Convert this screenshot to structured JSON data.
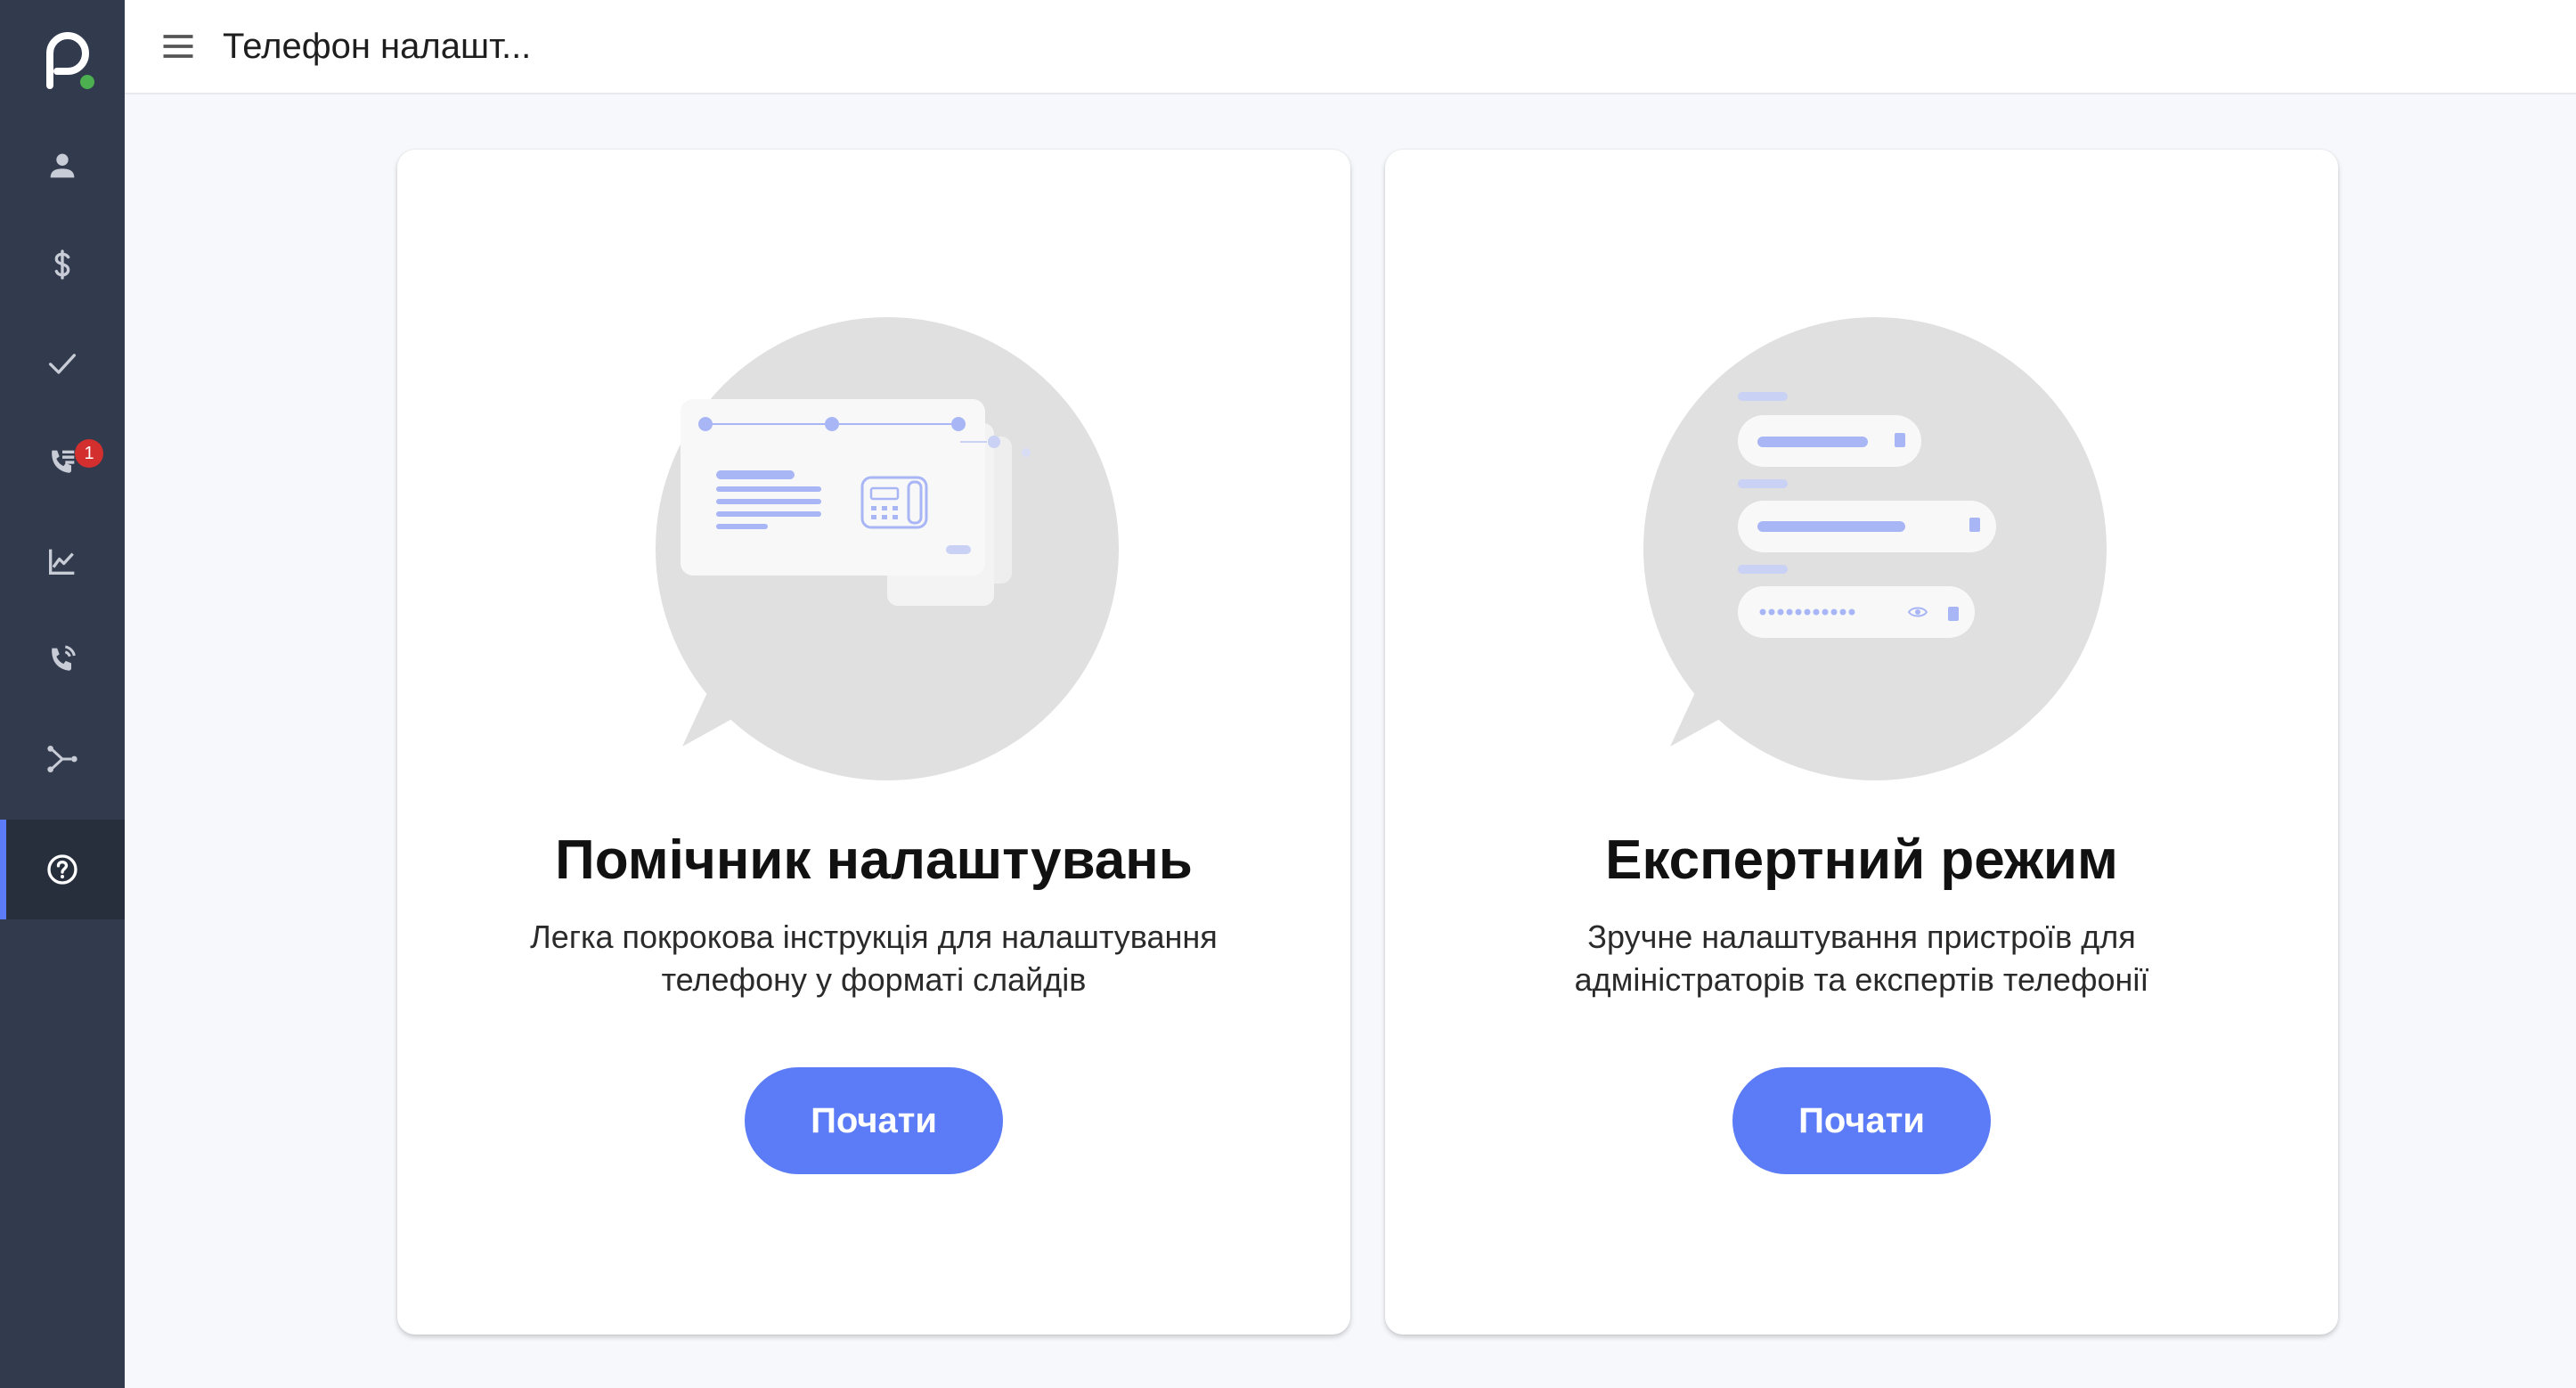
{
  "header": {
    "title": "Телефон налашт..."
  },
  "sidebar": {
    "items": [
      {
        "icon": "person-icon"
      },
      {
        "icon": "dollar-icon"
      },
      {
        "icon": "checkmark-icon"
      },
      {
        "icon": "call-list-icon",
        "badge": "1"
      },
      {
        "icon": "chart-icon"
      },
      {
        "icon": "phone-callback-icon"
      },
      {
        "icon": "routing-icon"
      },
      {
        "icon": "help-icon",
        "active": true
      }
    ]
  },
  "cards": [
    {
      "title": "Помічник налаштувань",
      "description": "Легка покрокова інструкція для налаштування телефону у форматі слайдів",
      "button": "Почати"
    },
    {
      "title": "Експертний режим",
      "description": "Зручне налаштування пристроїв для адміністраторів та експертів телефонії",
      "button": "Почати"
    }
  ],
  "colors": {
    "accent": "#5b7cf6",
    "sidebar": "#323b4d",
    "badge": "#d32f2f",
    "status_dot": "#4caf50",
    "illustration_bg": "#e0e0e0",
    "illustration_accent": "#a8b6f5"
  }
}
